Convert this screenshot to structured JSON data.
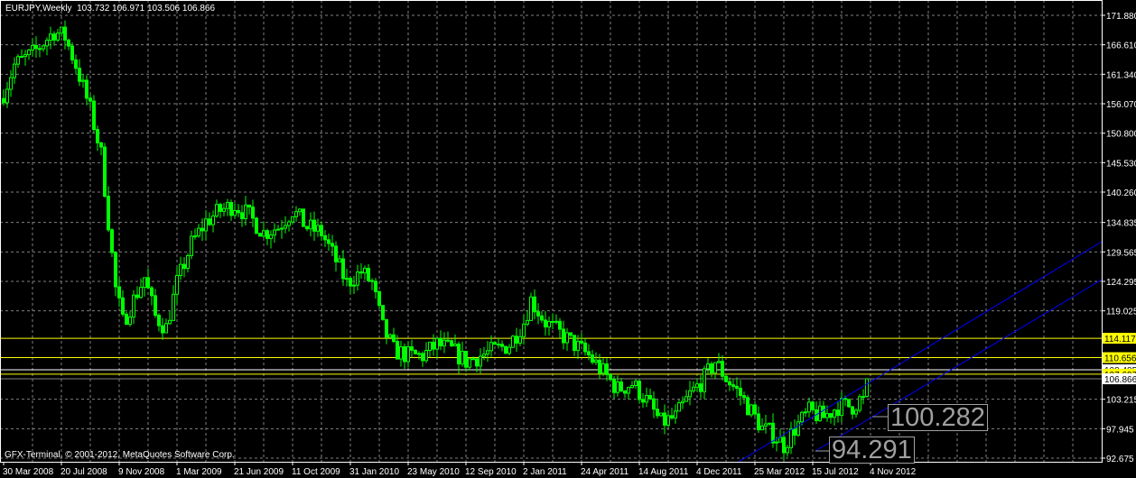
{
  "header": {
    "symbol": "EURJPY,Weekly",
    "ohlc": "103.732 106.971 103.506 106.866"
  },
  "footer": "GFX-Terminal, © 2001-2012, MetaQuotes Software Corp.",
  "colors": {
    "background": "#000000",
    "candle": "#00ff00",
    "grid": "#808080",
    "level": "#ffff00",
    "channel": "#0000ff",
    "axis": "#ffffff"
  },
  "chart_data": {
    "type": "candlestick",
    "symbol": "EURJPY",
    "timeframe": "Weekly",
    "ylim": [
      92.675,
      171.88
    ],
    "y_ticks": [
      "171.880",
      "166.610",
      "161.340",
      "156.070",
      "150.800",
      "145.530",
      "140.260",
      "134.835",
      "129.565",
      "124.295",
      "119.025",
      "103.215",
      "97.945",
      "92.675"
    ],
    "x_ticks": [
      "30 Mar 2008",
      "20 Jul 2008",
      "9 Nov 2008",
      "1 Mar 2009",
      "21 Jun 2009",
      "11 Oct 2009",
      "31 Jan 2010",
      "23 May 2010",
      "12 Sep 2010",
      "2 Jan 2011",
      "24 Apr 2011",
      "14 Aug 2011",
      "4 Dec 2011",
      "25 Mar 2012",
      "15 Jul 2012",
      "4 Nov 2012"
    ],
    "weeks_per_x_tick": 16,
    "close_path_week_price": [
      [
        0,
        158
      ],
      [
        3,
        163
      ],
      [
        8,
        165
      ],
      [
        14,
        169
      ],
      [
        17,
        168
      ],
      [
        20,
        163
      ],
      [
        24,
        155
      ],
      [
        27,
        147
      ],
      [
        29,
        135
      ],
      [
        31,
        123
      ],
      [
        33,
        117
      ],
      [
        36,
        121
      ],
      [
        39,
        125
      ],
      [
        42,
        118
      ],
      [
        45,
        116
      ],
      [
        48,
        124
      ],
      [
        52,
        131
      ],
      [
        56,
        135
      ],
      [
        60,
        137
      ],
      [
        64,
        138
      ],
      [
        68,
        136
      ],
      [
        72,
        133
      ],
      [
        76,
        134
      ],
      [
        80,
        137
      ],
      [
        84,
        134
      ],
      [
        88,
        133
      ],
      [
        92,
        128
      ],
      [
        95,
        124
      ],
      [
        99,
        126
      ],
      [
        102,
        124
      ],
      [
        105,
        116
      ],
      [
        108,
        112
      ],
      [
        112,
        111
      ],
      [
        116,
        111
      ],
      [
        120,
        113
      ],
      [
        124,
        112
      ],
      [
        128,
        110
      ],
      [
        132,
        111
      ],
      [
        136,
        112
      ],
      [
        140,
        113
      ],
      [
        144,
        117
      ],
      [
        146,
        121
      ],
      [
        150,
        117
      ],
      [
        154,
        115
      ],
      [
        158,
        113
      ],
      [
        162,
        111
      ],
      [
        166,
        108
      ],
      [
        170,
        105
      ],
      [
        174,
        106
      ],
      [
        178,
        103
      ],
      [
        182,
        99
      ],
      [
        186,
        100
      ],
      [
        190,
        104
      ],
      [
        194,
        107
      ],
      [
        197,
        110
      ],
      [
        200,
        107
      ],
      [
        204,
        104
      ],
      [
        207,
        101
      ],
      [
        210,
        98
      ],
      [
        213,
        97
      ],
      [
        216,
        95
      ],
      [
        219,
        98
      ],
      [
        223,
        101
      ],
      [
        227,
        100
      ],
      [
        231,
        102
      ],
      [
        235,
        102
      ],
      [
        238,
        103.7
      ],
      [
        239,
        106.866
      ]
    ],
    "horizontal_levels": [
      {
        "price": "114.117",
        "color": "#ffff00"
      },
      {
        "price": "110.656",
        "color": "#ffff00"
      },
      {
        "price": "108.485",
        "color": "#ffffff"
      },
      {
        "price": "107.697",
        "color": "#ffff00"
      },
      {
        "price": "106.866",
        "color": "#808080"
      }
    ],
    "price_labels": [
      "100.282",
      "94.291"
    ]
  }
}
